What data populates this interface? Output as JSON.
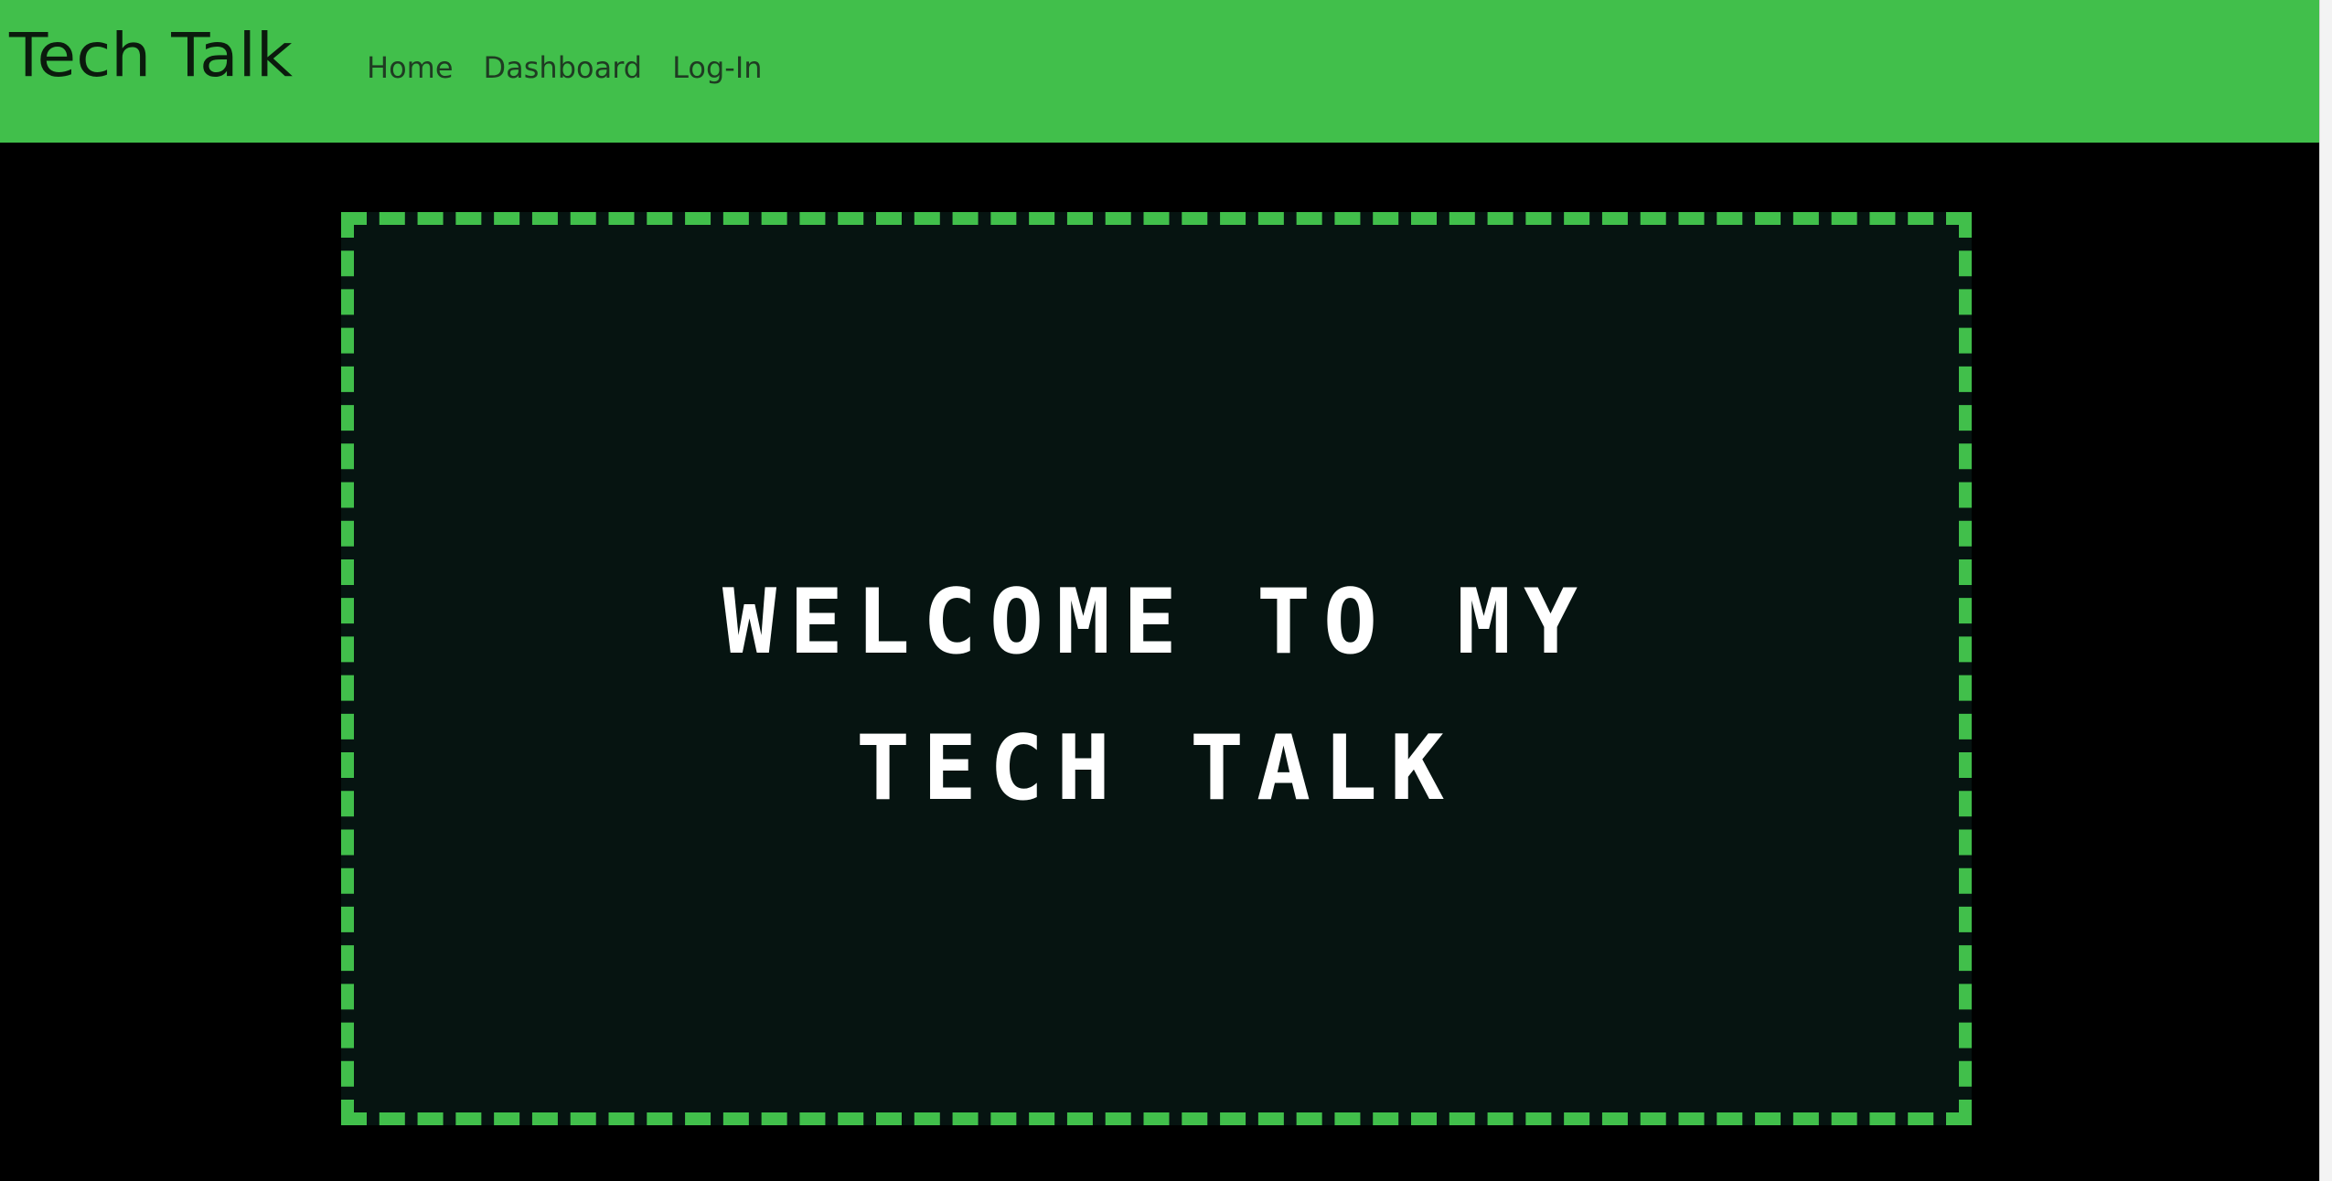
{
  "navbar": {
    "brand": "Tech Talk",
    "links": [
      {
        "label": "Home"
      },
      {
        "label": "Dashboard"
      },
      {
        "label": "Log-In"
      }
    ]
  },
  "hero": {
    "title_line1": "WELCOME TO MY",
    "title_line2": "TECH TALK"
  },
  "colors": {
    "accent_green": "#41bf4b",
    "page_background": "#000000",
    "hero_background": "#061411",
    "hero_text": "#ffffff"
  }
}
